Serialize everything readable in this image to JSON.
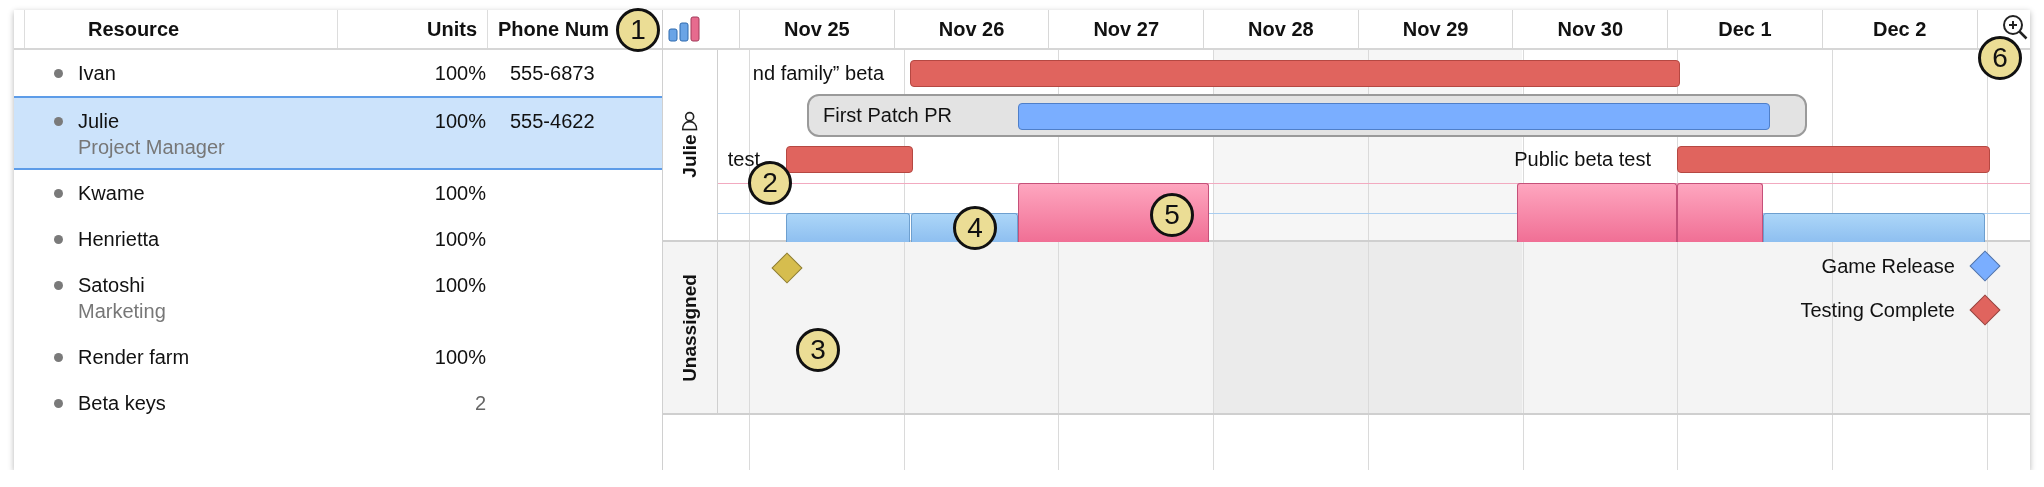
{
  "resource_table": {
    "columns": [
      "Resource",
      "Units",
      "Phone Num"
    ],
    "rows": [
      {
        "name": "Ivan",
        "units": "100%",
        "phone": "555-6873",
        "kind": "staff",
        "selected": false
      },
      {
        "name": "Julie",
        "units": "100%",
        "phone": "555-4622",
        "note": "Project Manager",
        "kind": "staff",
        "selected": true
      },
      {
        "name": "Kwame",
        "units": "100%",
        "kind": "staff",
        "selected": false
      },
      {
        "name": "Henrietta",
        "units": "100%",
        "kind": "staff",
        "selected": false
      },
      {
        "name": "Satoshi",
        "units": "100%",
        "note": "Marketing",
        "kind": "staff",
        "selected": false
      },
      {
        "name": "Render farm",
        "units": "100%",
        "kind": "staff",
        "selected": false
      },
      {
        "name": "Beta keys",
        "units": "2",
        "kind": "material",
        "selected": false
      }
    ]
  },
  "gantt": {
    "days": [
      "Nov 25",
      "Nov 26",
      "Nov 27",
      "Nov 28",
      "Nov 29",
      "Nov 30",
      "Dec 1",
      "Dec 2"
    ],
    "lanes": [
      {
        "label": "Julie",
        "kind": "resource",
        "tasks": [
          {
            "label": "nd family” beta",
            "kind": "task",
            "color": "#e0645e"
          },
          {
            "label": "First Patch PR",
            "kind": "group",
            "color": "#7aaeff"
          },
          {
            "label": "test",
            "kind": "task",
            "color": "#e0645e"
          },
          {
            "label": "Public beta test",
            "kind": "task",
            "color": "#e0645e"
          }
        ]
      },
      {
        "label": "Unassigned",
        "kind": "unassigned",
        "milestones": [
          {
            "color": "#d6bd4e"
          },
          {
            "label": "Game Release",
            "color": "#7aaeff"
          },
          {
            "label": "Testing Complete",
            "color": "#e0645e"
          }
        ]
      }
    ]
  },
  "callouts": [
    "1",
    "2",
    "3",
    "4",
    "5",
    "6"
  ]
}
